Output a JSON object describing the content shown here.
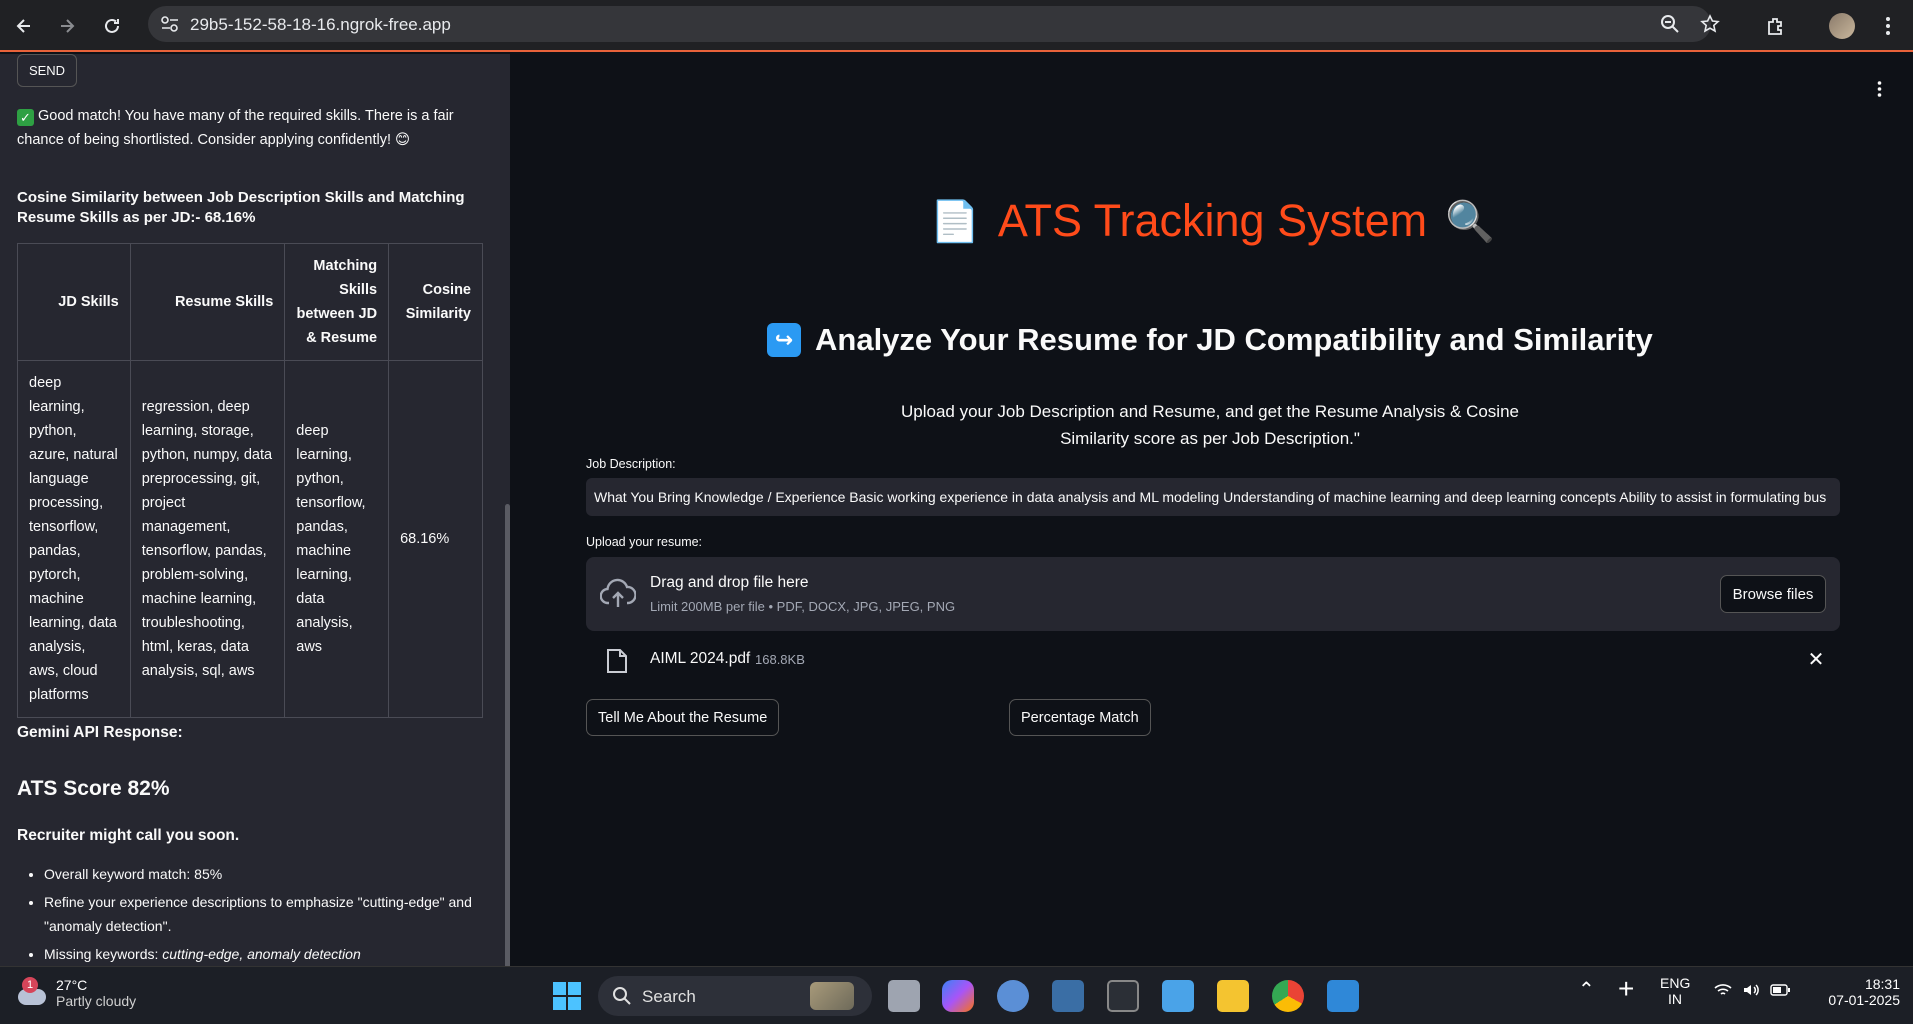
{
  "browser": {
    "url": "29b5-152-58-18-16.ngrok-free.app"
  },
  "sidebar": {
    "send_label": "SEND",
    "good_match": "Good match! You have many of the required skills. There is a fair chance of being shortlisted. Consider applying confidently! 😊",
    "cosine_title": "Cosine Similarity between Job Description Skills and Matching Resume Skills as per JD:- 68.16%",
    "table": {
      "headers": [
        "JD Skills",
        "Resume Skills",
        "Matching Skills between JD & Resume",
        "Cosine Similarity"
      ],
      "rows": [
        [
          "deep learning, python, azure, natural language processing, tensorflow, pandas, pytorch, machine learning, data analysis, aws, cloud platforms",
          "regression, deep learning, storage, python, numpy, data preprocessing, git, project management, tensorflow, pandas, problem-solving, machine learning, troubleshooting, html, keras, data analysis, sql, aws",
          "deep learning, python, tensorflow, pandas, machine learning, data analysis, aws",
          "68.16%"
        ]
      ]
    },
    "gemini_label": "Gemini API Response:",
    "ats_score": "ATS Score 82%",
    "recruiter": "Recruiter might call you soon.",
    "tips": [
      "Overall keyword match: 85%",
      "Refine your experience descriptions to emphasize \"cutting-edge\" and \"anomaly detection\".",
      "Missing keywords: "
    ],
    "missing_keywords": "cutting-edge, anomaly detection"
  },
  "main": {
    "title": "ATS Tracking System",
    "title_icon_left": "📄",
    "title_icon_right": "🔍",
    "subtitle": "Analyze Your Resume for JD Compatibility and Similarity",
    "upload_desc": "Upload your Job Description and Resume, and get the Resume Analysis & Cosine Similarity score as per Job Description.\"",
    "jd_label": "Job Description:",
    "jd_value": "What You Bring  Knowledge / Experience  Basic working experience in data analysis and ML modeling Understanding of machine learning and deep learning concepts Ability to assist in formulating bus",
    "resume_label": "Upload your resume:",
    "drop_title": "Drag and drop file here",
    "drop_limit": "Limit 200MB per file • PDF, DOCX, JPG, JPEG, PNG",
    "browse_label": "Browse files",
    "file_name": "AIML 2024.pdf",
    "file_size": "168.8KB",
    "btn_tell": "Tell Me About the Resume",
    "btn_percent": "Percentage Match"
  },
  "taskbar": {
    "temp": "27°C",
    "condition": "Partly cloudy",
    "weather_badge": "1",
    "search": "Search",
    "lang": "ENG",
    "region": "IN",
    "time": "18:31",
    "date": "07-01-2025"
  },
  "colors": {
    "accent_title": "#ff4b1a",
    "background": "#0e1117",
    "sidebar": "#262730"
  }
}
